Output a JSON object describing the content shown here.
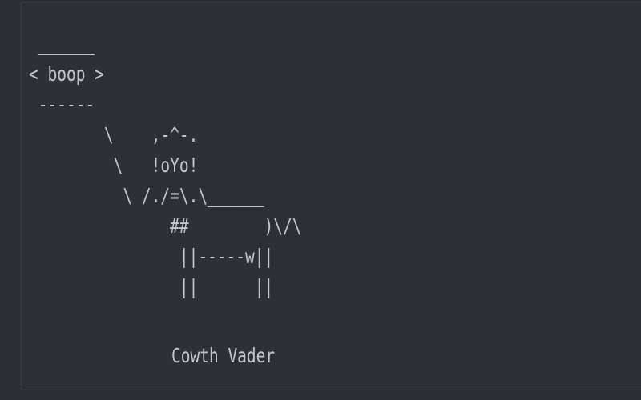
{
  "terminal": {
    "art": " ______\n< boop >\n ------\n        \\    ,-^-.\n         \\   !oYo!\n          \\ /./=\\.\\______\n               ##        )\\/\\\n                ||-----w||\n                ||      ||",
    "caption": "Cowth Vader"
  },
  "colors": {
    "background": "#2b2e33",
    "panel": "#2d3035",
    "text": "#c3c8cf"
  }
}
